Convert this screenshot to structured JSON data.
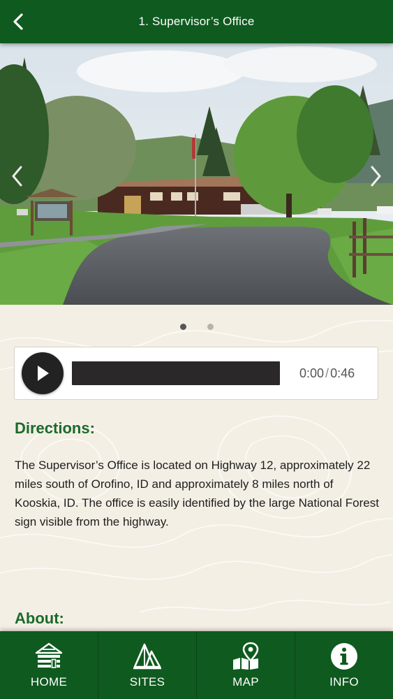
{
  "header": {
    "title": "1. Supervisor’s Office",
    "back_icon": "chevron-left-icon"
  },
  "carousel": {
    "image_count": 2,
    "active_index": 0,
    "prev_icon": "chevron-left-icon",
    "next_icon": "chevron-right-icon"
  },
  "audio": {
    "current_time": "0:00",
    "separator": "/",
    "duration": "0:46",
    "progress_fraction": 0,
    "play_icon": "play-icon"
  },
  "directions": {
    "heading": "Directions:",
    "body": "The Supervisor’s Office is located on Highway 12, approximately 22 miles south of Orofino, ID and approximately 8 miles north of Kooskia, ID. The office is easily identified by the large National Forest sign visible from the highway."
  },
  "about": {
    "heading": "About:"
  },
  "tabbar": {
    "tabs": [
      {
        "label": "HOME",
        "icon": "home-icon"
      },
      {
        "label": "SITES",
        "icon": "sites-icon"
      },
      {
        "label": "MAP",
        "icon": "map-icon"
      },
      {
        "label": "INFO",
        "icon": "info-icon"
      }
    ]
  },
  "colors": {
    "brand_green": "#0f5a1f",
    "heading_green": "#1b6a2a",
    "background": "#f4efe5"
  }
}
